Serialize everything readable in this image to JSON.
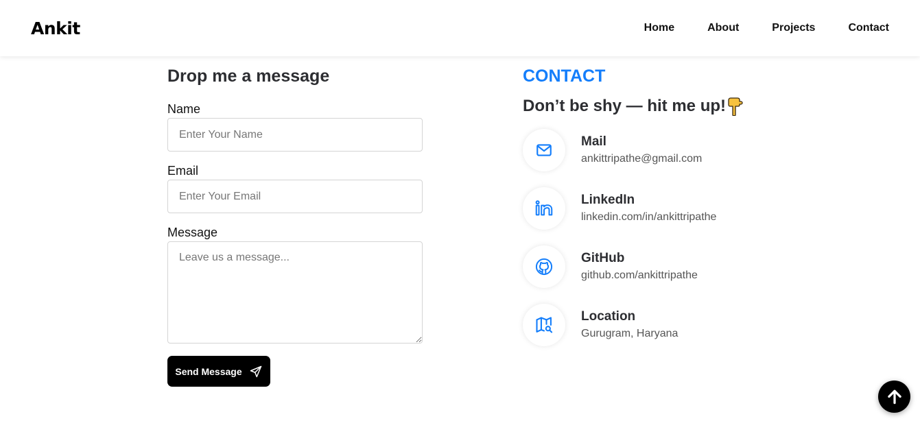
{
  "nav": {
    "brand": "Ankit",
    "links": [
      "Home",
      "About",
      "Projects",
      "Contact"
    ]
  },
  "form": {
    "title": "Drop me a message",
    "name_label": "Name",
    "name_placeholder": "Enter Your Name",
    "email_label": "Email",
    "email_placeholder": "Enter Your Email",
    "message_label": "Message",
    "message_placeholder": "Leave us a message...",
    "submit_label": "Send Message",
    "submit_icon": "send-icon"
  },
  "contact": {
    "kicker": "CONTACT",
    "heading": "Don’t be shy — hit me up!",
    "heading_emoji": "👇",
    "accent_color": "#147efb",
    "items": [
      {
        "icon": "mail-icon",
        "label": "Mail",
        "value": "ankittripathe@gmail.com"
      },
      {
        "icon": "linkedin-icon",
        "label": "LinkedIn",
        "value": "linkedin.com/in/ankittripathe"
      },
      {
        "icon": "github-icon",
        "label": "GitHub",
        "value": "github.com/ankittripathe"
      },
      {
        "icon": "map-location-icon",
        "label": "Location",
        "value": "Gurugram, Haryana"
      }
    ]
  },
  "scroll_top": {
    "icon": "arrow-up-icon"
  }
}
